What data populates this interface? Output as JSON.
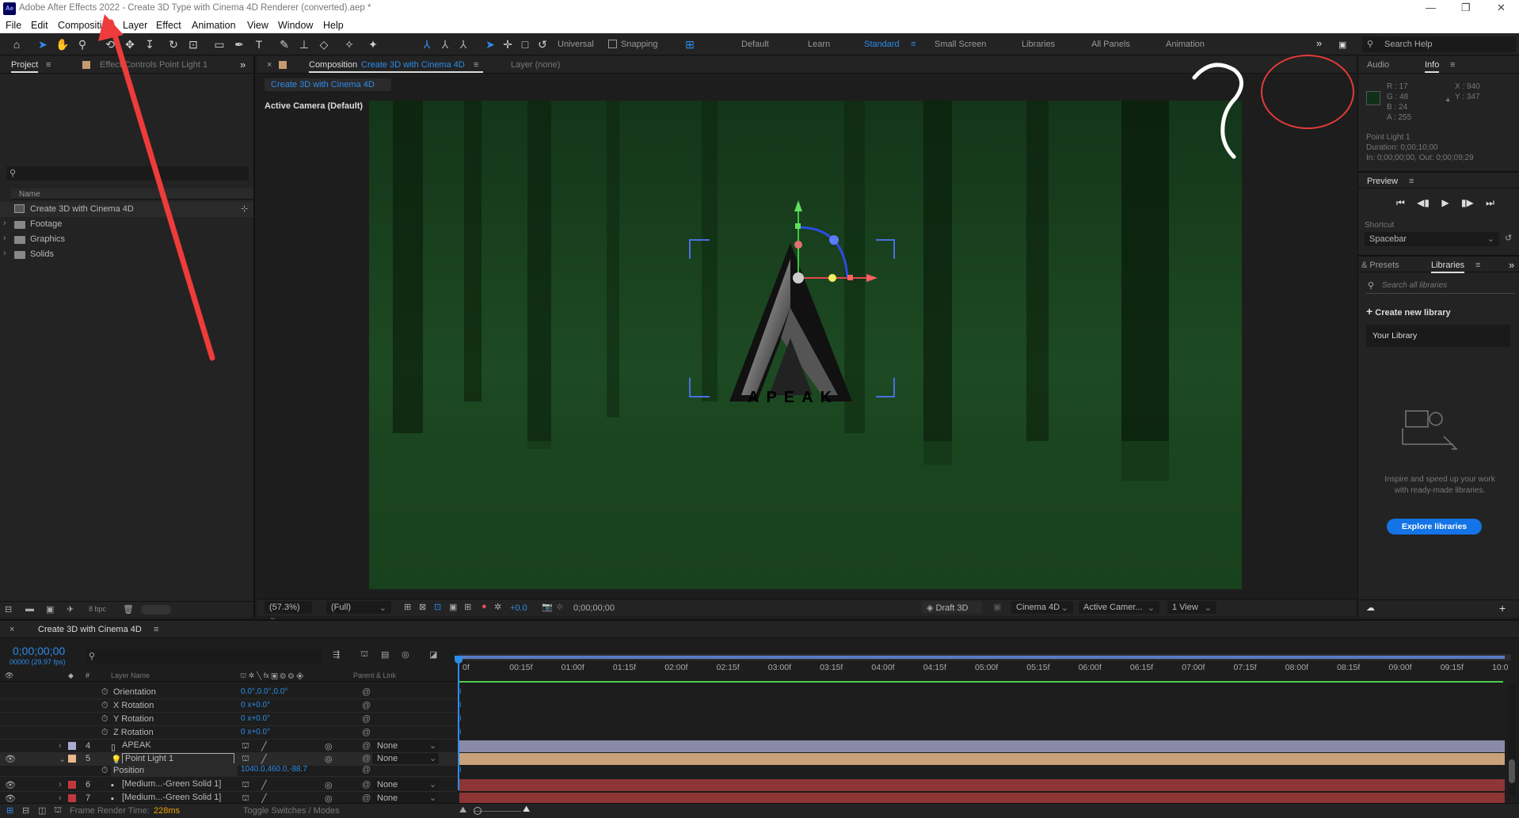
{
  "app": {
    "title": "Adobe After Effects 2022 - Create 3D Type with Cinema 4D Renderer (converted).aep *",
    "logo": "Ae"
  },
  "menu": [
    "File",
    "Edit",
    "Composition",
    "Layer",
    "Effect",
    "Animation",
    "View",
    "Window",
    "Help"
  ],
  "toolbar": {
    "universal": "Universal",
    "snapping": "Snapping",
    "workspaces": [
      "Default",
      "Learn",
      "Standard",
      "Small Screen",
      "Libraries",
      "All Panels",
      "Animation"
    ],
    "active_workspace": "Standard",
    "search_help": "Search Help"
  },
  "project": {
    "tab": "Project",
    "effect_controls_tab": "Effect Controls Point Light 1",
    "col_name": "Name",
    "items": [
      {
        "name": "Create 3D with Cinema 4D",
        "type": "comp"
      },
      {
        "name": "Footage",
        "type": "folder"
      },
      {
        "name": "Graphics",
        "type": "folder"
      },
      {
        "name": "Solids",
        "type": "folder"
      }
    ],
    "bpc": "8 bpc"
  },
  "composition": {
    "tab_label": "Composition",
    "tab_name": "Create 3D with Cinema 4D",
    "layer_tab": "Layer (none)",
    "subtab": "Create 3D with Cinema 4D",
    "active_camera": "Active Camera (Default)",
    "logo_text": "APEAK",
    "zoom": "(57.3%)",
    "resolution": "(Full)",
    "exposure": "+0.0",
    "timecode": "0;00;00;00",
    "draft3d": "Draft 3D",
    "renderer": "Cinema 4D",
    "camera_select": "Active Camer...",
    "views": "1 View"
  },
  "info": {
    "audio_tab": "Audio",
    "info_tab": "Info",
    "r": "R : 17",
    "g": "G : 48",
    "b": "B : 24",
    "a": "A : 255",
    "x": "X : 940",
    "y": "Y : 347",
    "swatch": "#113018",
    "layer": "Point Light 1",
    "duration": "Duration: 0;00;10;00",
    "inout": "In: 0;00;00;00, Out: 0;00;09;29"
  },
  "preview": {
    "title": "Preview",
    "shortcut_label": "Shortcut",
    "shortcut_value": "Spacebar"
  },
  "libraries": {
    "presets_tab": "& Presets",
    "libraries_tab": "Libraries",
    "search_placeholder": "Search all libraries",
    "create": "Create new library",
    "your_library": "Your Library",
    "desc": "Inspire and speed up your work with ready-made libraries.",
    "explore": "Explore libraries"
  },
  "timeline": {
    "comp_tab": "Create 3D with Cinema 4D",
    "timecode": "0;00;00;00",
    "fps": "00000 (29.97 fps)",
    "col_layer": "Layer Name",
    "col_parent": "Parent & Link",
    "ticks": [
      "0f",
      "00:15f",
      "01:00f",
      "01:15f",
      "02:00f",
      "02:15f",
      "03:00f",
      "03:15f",
      "04:00f",
      "04:15f",
      "05:00f",
      "05:15f",
      "06:00f",
      "06:15f",
      "07:00f",
      "07:15f",
      "08:00f",
      "08:15f",
      "09:00f",
      "09:15f",
      "10:0"
    ],
    "props": [
      {
        "name": "Orientation",
        "value": "0.0°,0.0°,0.0°"
      },
      {
        "name": "X Rotation",
        "value": "0 x+0.0°"
      },
      {
        "name": "Y Rotation",
        "value": "0 x+0.0°"
      },
      {
        "name": "Z Rotation",
        "value": "0 x+0.0°"
      }
    ],
    "layers": [
      {
        "num": "4",
        "name": "APEAK",
        "parent": "None",
        "label": "#a9a9d6",
        "bar": "#8a8aa8"
      },
      {
        "num": "5",
        "name": "Point Light 1",
        "parent": "None",
        "label": "#e8b98a",
        "bar": "#c9a27a"
      },
      {
        "num": "6",
        "name": "[Medium...-Green Solid 1]",
        "parent": "None",
        "label": "#c0383f",
        "bar": "#8e3535"
      },
      {
        "num": "7",
        "name": "[Medium...-Green Solid 1]",
        "parent": "None",
        "label": "#c0383f",
        "bar": "#8e3535"
      }
    ],
    "position_label": "Position",
    "position_value": "1040.0,460.0,-88.7",
    "frame_render": "Frame Render Time:",
    "frame_render_value": "228ms",
    "toggle": "Toggle Switches / Modes"
  }
}
